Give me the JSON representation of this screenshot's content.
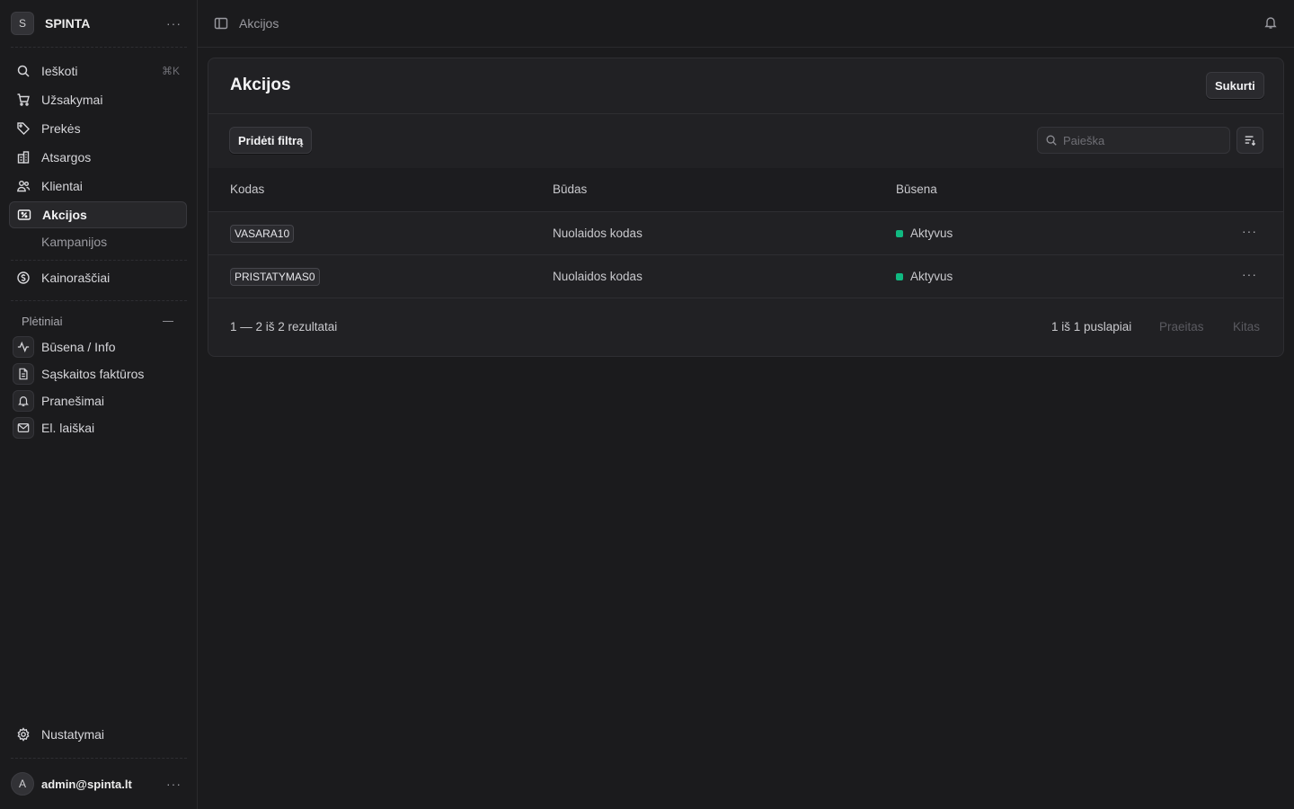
{
  "store": {
    "avatar_letter": "S",
    "name": "SPINTA"
  },
  "sidebar": {
    "search": {
      "label": "Ieškoti",
      "shortcut": "⌘K"
    },
    "items": [
      {
        "label": "Užsakymai",
        "icon": "cart-icon"
      },
      {
        "label": "Prekės",
        "icon": "tag-icon"
      },
      {
        "label": "Atsargos",
        "icon": "buildings-icon"
      },
      {
        "label": "Klientai",
        "icon": "users-icon"
      },
      {
        "label": "Akcijos",
        "icon": "receipt-percent-icon",
        "active": true
      }
    ],
    "sub_items": [
      {
        "label": "Kampanijos"
      }
    ],
    "pricing": {
      "label": "Kainoraščiai",
      "icon": "currency-icon"
    },
    "extensions_title": "Plėtiniai",
    "extensions": [
      {
        "label": "Būsena / Info",
        "icon": "activity-icon"
      },
      {
        "label": "Sąskaitos faktūros",
        "icon": "document-icon"
      },
      {
        "label": "Pranešimai",
        "icon": "bell-icon"
      },
      {
        "label": "El. laiškai",
        "icon": "envelope-icon"
      }
    ],
    "settings": {
      "label": "Nustatymai",
      "icon": "gear-icon"
    },
    "user": {
      "avatar_letter": "A",
      "email": "admin@spinta.lt"
    }
  },
  "topbar": {
    "breadcrumb": "Akcijos"
  },
  "page": {
    "title": "Akcijos",
    "create_label": "Sukurti",
    "add_filter_label": "Pridėti filtrą",
    "search_placeholder": "Paieška"
  },
  "table": {
    "columns": [
      "Kodas",
      "Būdas",
      "Būsena"
    ],
    "rows": [
      {
        "code": "VASARA10",
        "method": "Nuolaidos kodas",
        "status": "Aktyvus"
      },
      {
        "code": "PRISTATYMAS0",
        "method": "Nuolaidos kodas",
        "status": "Aktyvus"
      }
    ]
  },
  "pagination": {
    "range": "1 — 2 iš 2 rezultatai",
    "pages": "1 iš 1 puslapiai",
    "prev": "Praeitas",
    "next": "Kitas"
  },
  "colors": {
    "status_active": "#10b981",
    "background": "#1b1b1d",
    "card": "#212124"
  }
}
